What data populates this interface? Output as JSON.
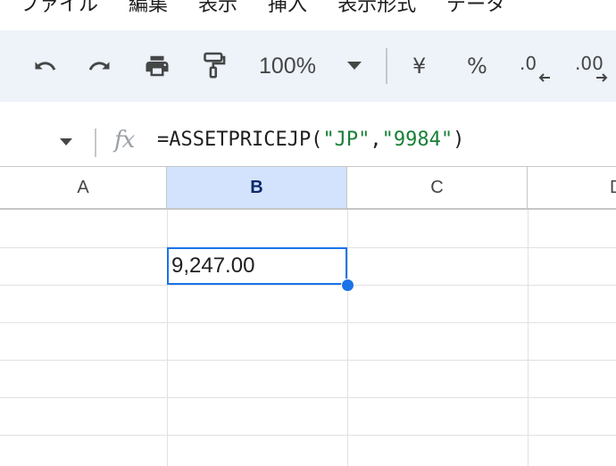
{
  "menu": {
    "items": [
      "ファイル",
      "編集",
      "表示",
      "挿入",
      "表示形式",
      "データ"
    ]
  },
  "toolbar": {
    "icons": [
      "undo-icon",
      "redo-icon",
      "print-icon",
      "paint-format-icon",
      "chevron-down-icon"
    ],
    "zoom": "100%",
    "currency_symbol": "¥",
    "percent_symbol": "%",
    "decrease_decimals_label": ".0",
    "increase_decimals_label": ".00"
  },
  "formula_bar": {
    "fx_label": "fx",
    "formula_prefix": "=ASSETPRICEJP(",
    "arg1": "\"JP\"",
    "comma": ",",
    "arg2": "\"9984\"",
    "formula_suffix": ")"
  },
  "grid": {
    "columns": [
      "A",
      "B",
      "C",
      "D"
    ],
    "selected_column": "B",
    "selected_cell_value": "9,247.00"
  },
  "colors": {
    "toolbar_bg": "#eef2f9",
    "selection": "#1a73e8",
    "selected_header_bg": "#d3e3fd",
    "formula_string": "#188038"
  }
}
